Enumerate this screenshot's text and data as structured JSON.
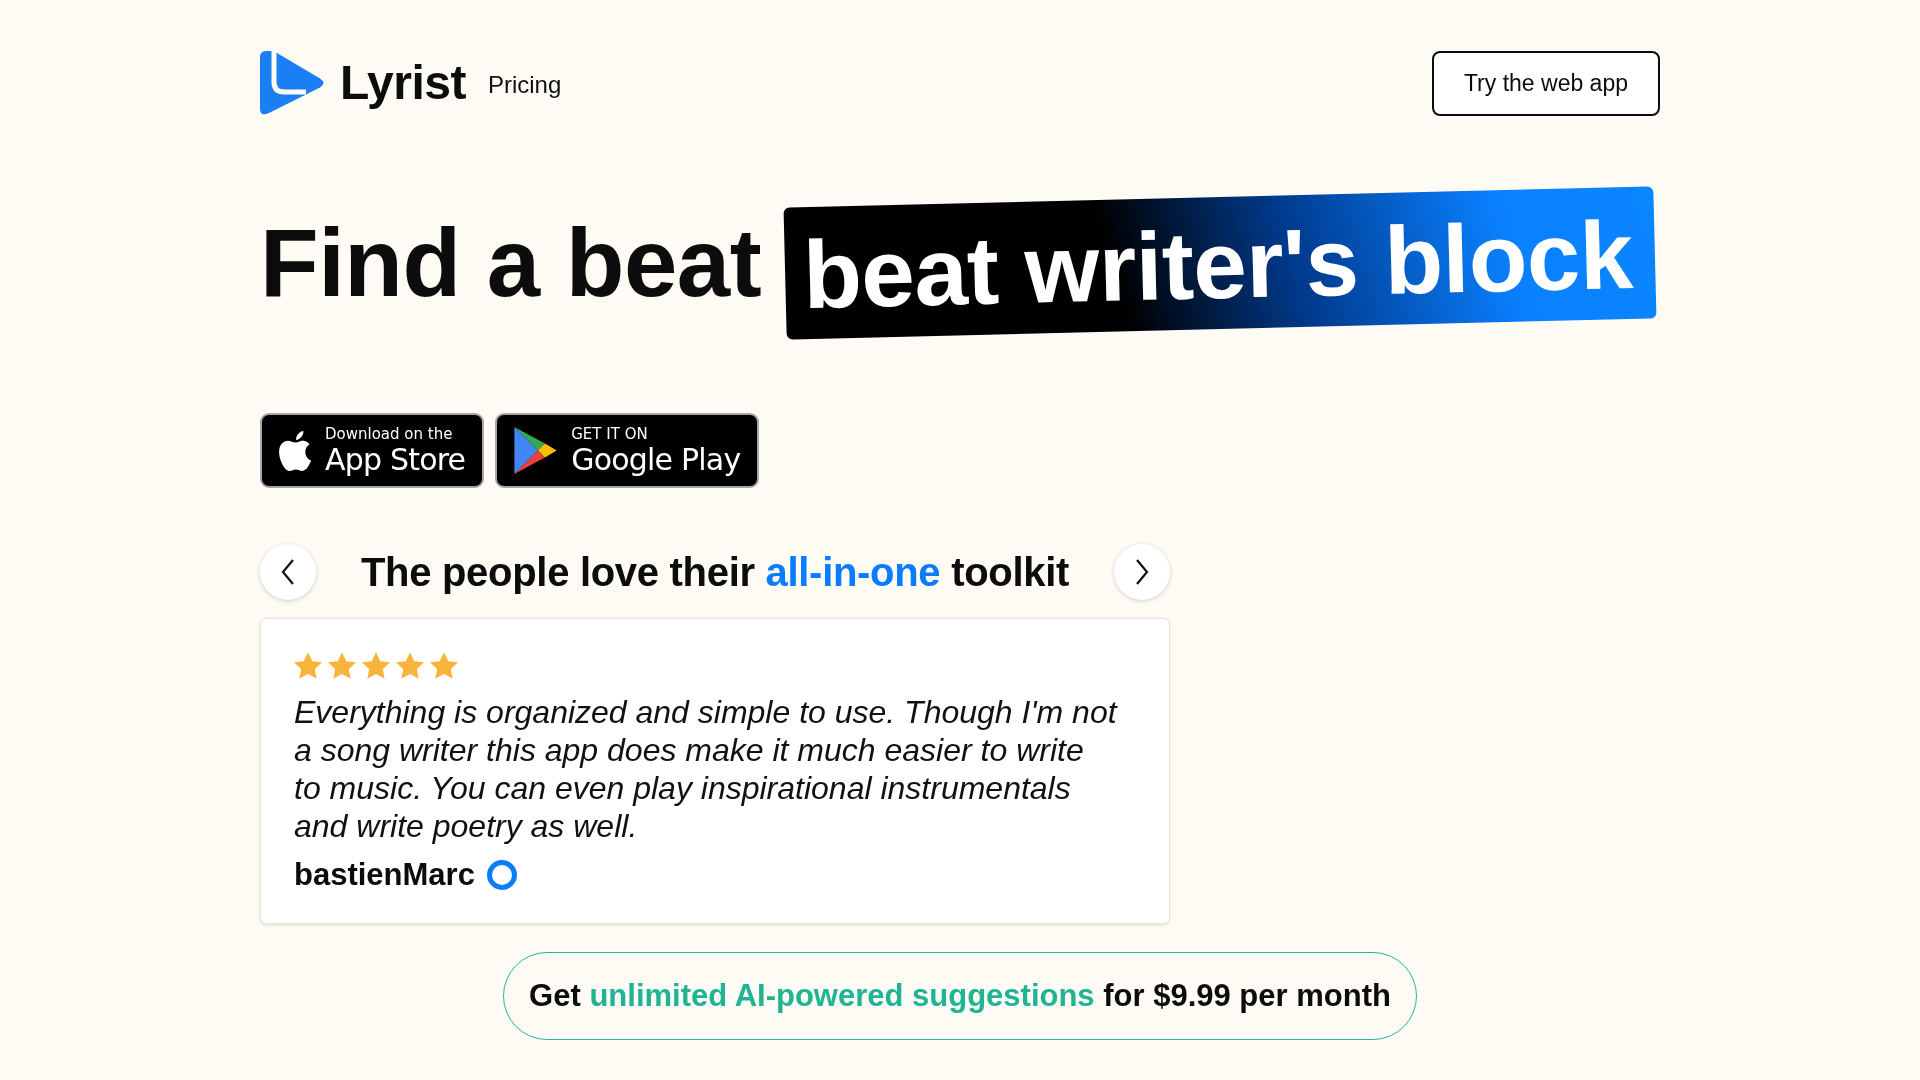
{
  "header": {
    "brand": "Lyrist",
    "nav_links": [
      "Pricing"
    ],
    "cta_button": "Try the web app"
  },
  "hero": {
    "headline": "Find a beat",
    "highlight": "beat writer's block"
  },
  "store_badges": [
    {
      "kind": "apple",
      "caption": "Download on the",
      "label": "App Store"
    },
    {
      "kind": "google_play",
      "caption": "GET IT ON",
      "label": "Google Play"
    }
  ],
  "reviews": {
    "title": [
      {
        "text": "The people love their ",
        "accent": false
      },
      {
        "text": "all-in-one",
        "accent": true
      },
      {
        "text": " toolkit",
        "accent": false
      }
    ],
    "review": {
      "stars": 5,
      "quote": "Everything is organized and simple to use. Though I'm not a song writer this app does make it much easier to write to music. You can even play inspirational instrumentals and write poetry as well.",
      "author": "bastienMarc"
    }
  },
  "offer": [
    {
      "text": "Get ",
      "accent": false
    },
    {
      "text": "unlimited AI-powered suggestions",
      "accent": true
    },
    {
      "text": " for $9.99 per month",
      "accent": false
    }
  ]
}
